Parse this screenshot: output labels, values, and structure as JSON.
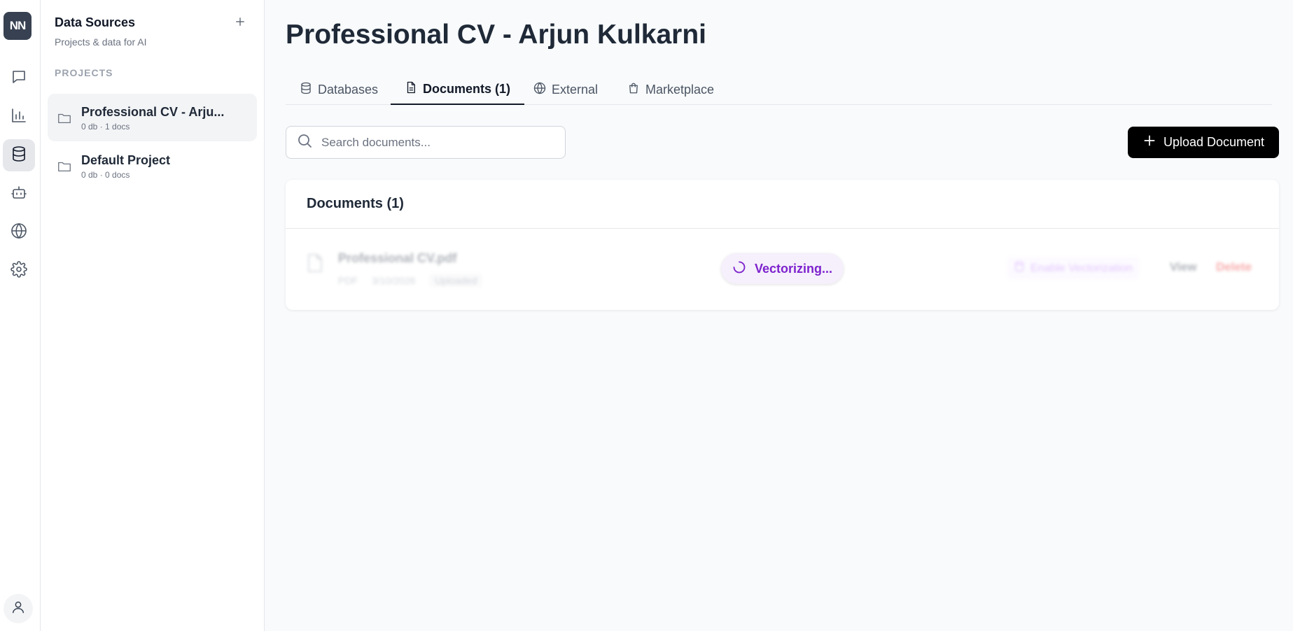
{
  "rail": {
    "logo_text": "NN",
    "items": [
      {
        "icon": "chat-icon"
      },
      {
        "icon": "bar-chart-icon"
      },
      {
        "icon": "database-icon",
        "active": true
      },
      {
        "icon": "robot-icon"
      },
      {
        "icon": "globe-icon"
      },
      {
        "icon": "gear-icon"
      }
    ],
    "avatar_icon": "user-icon"
  },
  "sidebar": {
    "title": "Data Sources",
    "subtitle": "Projects & data for AI",
    "section_label": "PROJECTS",
    "projects": [
      {
        "name": "Professional CV - Arju...",
        "meta": "0 db · 1 docs",
        "active": true
      },
      {
        "name": "Default Project",
        "meta": "0 db · 0 docs",
        "active": false
      }
    ]
  },
  "main": {
    "title": "Professional CV - Arjun Kulkarni",
    "tabs": [
      {
        "label": "Databases",
        "icon": "database-icon"
      },
      {
        "label": "Documents (1)",
        "icon": "document-icon",
        "active": true
      },
      {
        "label": "External",
        "icon": "globe-icon"
      },
      {
        "label": "Marketplace",
        "icon": "shopping-bag-icon"
      }
    ],
    "search": {
      "placeholder": "Search documents...",
      "value": ""
    },
    "upload_label": "Upload Document",
    "card": {
      "title": "Documents (1)",
      "documents": [
        {
          "name": "Professional CV.pdf",
          "type": "PDF",
          "date": "3/10/2026",
          "status": "Uploaded",
          "vectorizing_label": "Vectorizing...",
          "enable_label": "Enable Vectorization",
          "view_label": "View",
          "delete_label": "Delete"
        }
      ]
    }
  },
  "colors": {
    "accent": "#000000",
    "vectorizing": "#7e22ce",
    "delete": "#ef4444"
  }
}
